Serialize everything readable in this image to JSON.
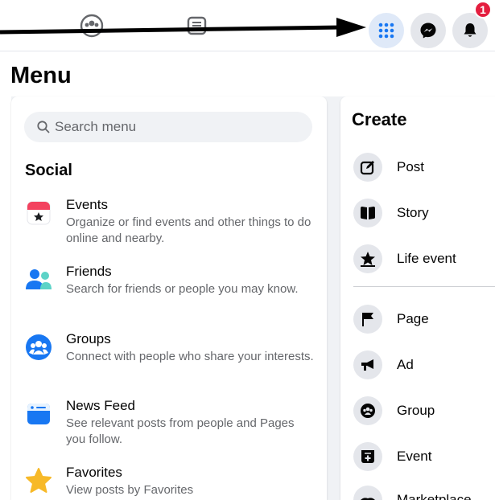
{
  "topbar": {
    "icons": [
      "groups-icon",
      "news-feed-icon"
    ],
    "notification_count": "1"
  },
  "menu": {
    "title": "Menu",
    "search": {
      "placeholder": "Search menu",
      "value": ""
    },
    "social": {
      "title": "Social",
      "items": [
        {
          "name": "Events",
          "desc": "Organize or find events and other things to do online and nearby.",
          "icon": "events-icon"
        },
        {
          "name": "Friends",
          "desc": "Search for friends or people you may know.",
          "icon": "friends-icon"
        },
        {
          "name": "Groups",
          "desc": "Connect with people who share your interests.",
          "icon": "groups-icon"
        },
        {
          "name": "News Feed",
          "desc": "See relevant posts from people and Pages you follow.",
          "icon": "news-feed-icon"
        },
        {
          "name": "Favorites",
          "desc": "View posts by Favorites",
          "icon": "star-icon"
        }
      ]
    }
  },
  "create": {
    "title": "Create",
    "items": [
      {
        "label": "Post",
        "icon": "edit-icon"
      },
      {
        "label": "Story",
        "icon": "book-icon"
      },
      {
        "label": "Life event",
        "icon": "star-icon"
      },
      {
        "label": "Page",
        "icon": "flag-icon"
      },
      {
        "label": "Ad",
        "icon": "megaphone-icon"
      },
      {
        "label": "Group",
        "icon": "group-icon"
      },
      {
        "label": "Event",
        "icon": "calendar-plus-icon"
      },
      {
        "label": "Marketplace",
        "icon": "handshake-icon"
      }
    ]
  },
  "colors": {
    "accent": "#1877f2",
    "badge": "#e41e3f",
    "panel_bg": "#f0f2f5",
    "secondary_text": "#65676b"
  }
}
